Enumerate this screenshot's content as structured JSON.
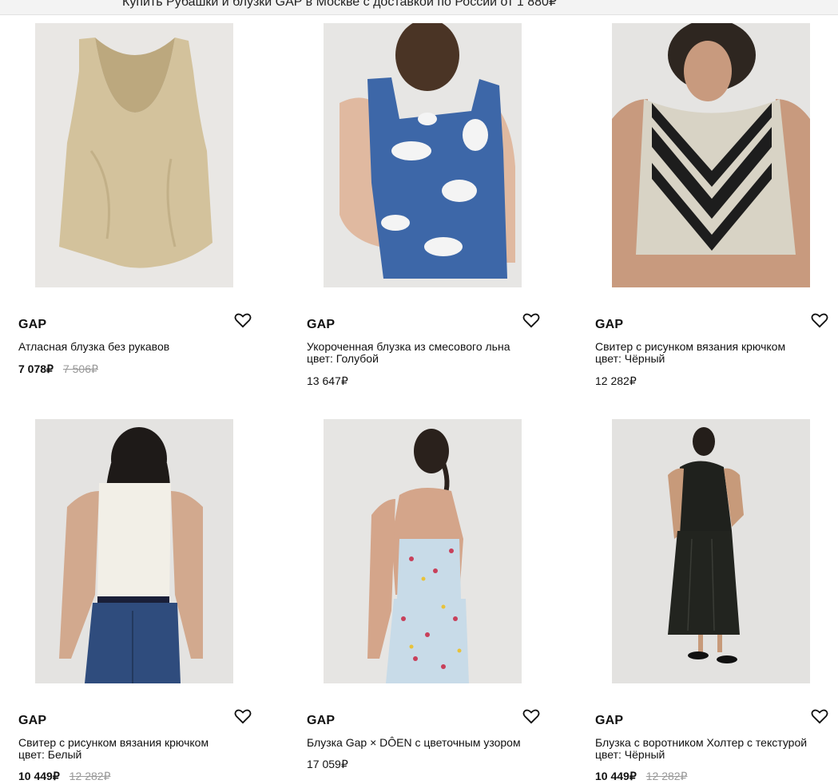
{
  "header": {
    "text": "Купить Рубашки и блузки GAP в Москве с доставкой по России от 1 880₽"
  },
  "products": [
    {
      "brand": "GAP",
      "title": "Атласная блузка без рукавов",
      "color": "",
      "price": "7 078₽",
      "old_price": "7 506₽"
    },
    {
      "brand": "GAP",
      "title": "Укороченная блузка из смесового льна",
      "color": "цвет: Голубой",
      "price": "13 647₽",
      "old_price": ""
    },
    {
      "brand": "GAP",
      "title": "Свитер с рисунком вязания крючком",
      "color": "цвет: Чёрный",
      "price": "12 282₽",
      "old_price": ""
    },
    {
      "brand": "GAP",
      "title": "Свитер с рисунком вязания крючком",
      "color": "цвет: Белый",
      "price": "10 449₽",
      "old_price": "12 282₽"
    },
    {
      "brand": "GAP",
      "title": "Блузка Gap × DÔEN с цветочным узором",
      "color": "",
      "price": "17 059₽",
      "old_price": ""
    },
    {
      "brand": "GAP",
      "title": "Блузка с воротником Холтер с текстурой",
      "color": "цвет: Чёрный",
      "price": "10 449₽",
      "old_price": "12 282₽"
    }
  ]
}
